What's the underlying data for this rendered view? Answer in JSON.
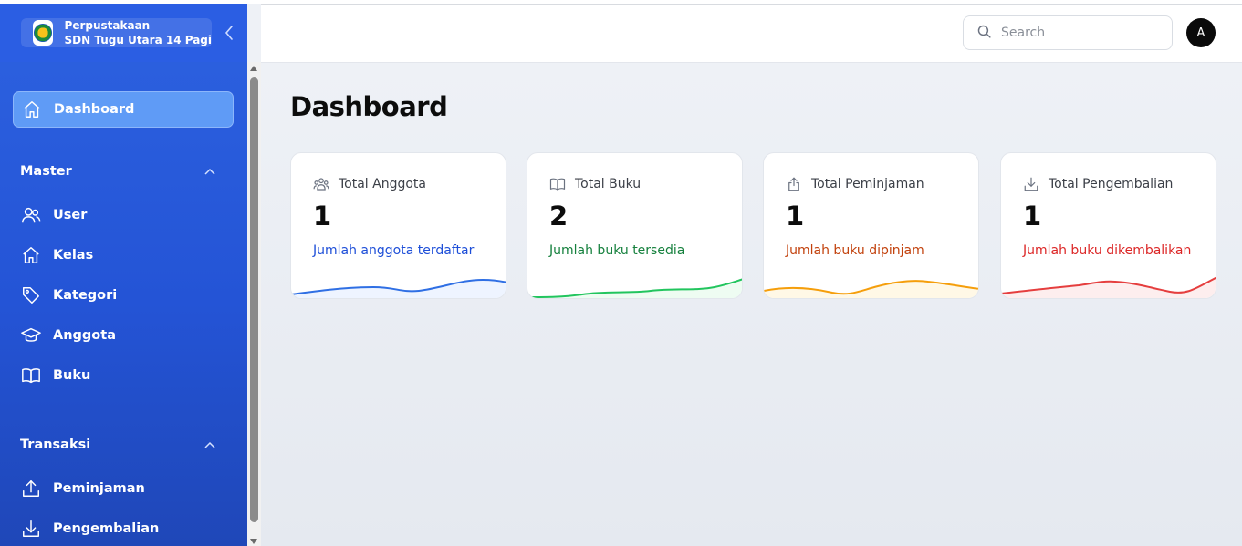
{
  "app": {
    "title_line1": "Perpustakaan",
    "title_line2": "SDN Tugu Utara 14 Pagi"
  },
  "sidebar": {
    "dashboard": {
      "label": "Dashboard",
      "icon": "home-icon"
    },
    "master": {
      "title": "Master",
      "items": [
        {
          "label": "User",
          "icon": "users-icon"
        },
        {
          "label": "Kelas",
          "icon": "home-icon"
        },
        {
          "label": "Kategori",
          "icon": "tag-icon"
        },
        {
          "label": "Anggota",
          "icon": "graduation-cap-icon"
        },
        {
          "label": "Buku",
          "icon": "book-icon"
        }
      ]
    },
    "transaksi": {
      "title": "Transaksi",
      "items": [
        {
          "label": "Peminjaman",
          "icon": "upload-icon"
        },
        {
          "label": "Pengembalian",
          "icon": "download-icon"
        }
      ]
    }
  },
  "header": {
    "search_placeholder": "Search",
    "avatar_initial": "A"
  },
  "main": {
    "title": "Dashboard",
    "cards": [
      {
        "title": "Total Anggota",
        "value": "1",
        "desc": "Jumlah anggota terdaftar",
        "color": "#1d4ed8",
        "wave_color": "#3b82f6",
        "icon": "users-icon"
      },
      {
        "title": "Total Buku",
        "value": "2",
        "desc": "Jumlah buku tersedia",
        "color": "#15803d",
        "wave_color": "#22c55e",
        "icon": "book-open-icon"
      },
      {
        "title": "Total Peminjaman",
        "value": "1",
        "desc": "Jumlah buku dipinjam",
        "color": "#c2410c",
        "wave_color": "#f59e0b",
        "icon": "share-upload-icon"
      },
      {
        "title": "Total Pengembalian",
        "value": "1",
        "desc": "Jumlah buku dikembalikan",
        "color": "#dc2626",
        "wave_color": "#ef4444",
        "icon": "download-icon"
      }
    ]
  },
  "colors": {
    "sidebar": "#2454d6",
    "active_item": "#5f9bf6"
  }
}
